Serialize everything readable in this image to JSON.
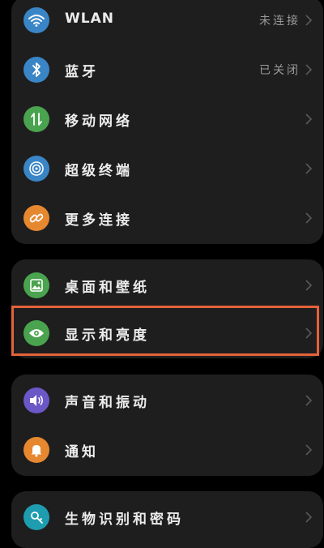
{
  "colors": {
    "wlan": "#3a85c6",
    "bluetooth": "#3a85c6",
    "mobile": "#4aa34e",
    "super_terminal": "#3a85c6",
    "more_connect": "#e6882f",
    "wallpaper": "#4aa34e",
    "display": "#4aa34e",
    "sound": "#6b57c5",
    "notify": "#e6882f",
    "security": "#1f9db0",
    "highlight": "#e5623a"
  },
  "group1": {
    "items": [
      {
        "label": "WLAN",
        "value": "未连接",
        "icon": "wifi-icon"
      },
      {
        "label": "蓝牙",
        "value": "已关闭",
        "icon": "bluetooth-icon"
      },
      {
        "label": "移动网络",
        "icon": "mobile-data-icon"
      },
      {
        "label": "超级终端",
        "icon": "super-terminal-icon"
      },
      {
        "label": "更多连接",
        "icon": "link-icon"
      }
    ]
  },
  "group2": {
    "items": [
      {
        "label": "桌面和壁纸",
        "icon": "wallpaper-icon"
      },
      {
        "label": "显示和亮度",
        "icon": "eye-icon"
      }
    ]
  },
  "group3": {
    "items": [
      {
        "label": "声音和振动",
        "icon": "volume-icon"
      },
      {
        "label": "通知",
        "icon": "bell-icon"
      }
    ]
  },
  "group4": {
    "items": [
      {
        "label": "生物识别和密码",
        "icon": "key-icon"
      }
    ]
  }
}
